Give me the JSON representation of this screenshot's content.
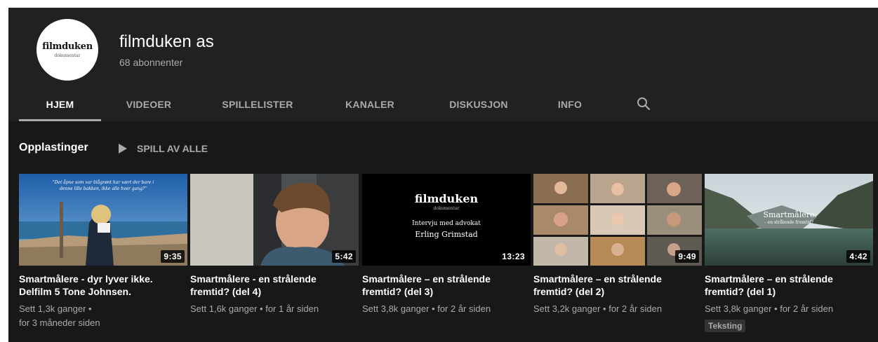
{
  "channel": {
    "name": "filmduken as",
    "subscribers": "68 abonnenter",
    "logo_text": "filmduken",
    "logo_subtext": "dokumentar"
  },
  "tabs": [
    {
      "label": "HJEM",
      "active": true
    },
    {
      "label": "VIDEOER"
    },
    {
      "label": "SPILLELISTER"
    },
    {
      "label": "KANALER"
    },
    {
      "label": "DISKUSJON"
    },
    {
      "label": "INFO"
    }
  ],
  "search_icon": "search-icon",
  "section": {
    "title": "Opplastinger",
    "play_all": "SPILL AV ALLE"
  },
  "videos": [
    {
      "duration": "9:35",
      "title": "Smartmålere - dyr lyver ikke. Delfilm 5 Tone Johnsen.",
      "views": "Sett 1,3k ganger •",
      "age": "for 3 måneder siden",
      "thumb_text": "\"Det åpne som var blågrønt har vært der bare i denne lille bakken, ikke alle hver gang?\""
    },
    {
      "duration": "5:42",
      "title": "Smartmålere - en strålende fremtid? (del 4)",
      "views": "Sett 1,6k ganger",
      "age": "for 1 år siden"
    },
    {
      "duration": "13:23",
      "title": "Smartmålere – en strålende fremtid? (del 3)",
      "views": "Sett 3,8k ganger",
      "age": "for 2 år siden",
      "thumb_brand": "filmduken",
      "thumb_brand_sub": "dokumentar",
      "thumb_line1": "Intervju med advokat",
      "thumb_line2": "Erling Grimstad"
    },
    {
      "duration": "9:49",
      "title": "Smartmålere – en strålende fremtid? (del 2)",
      "views": "Sett 3,2k ganger",
      "age": "for 2 år siden"
    },
    {
      "duration": "4:42",
      "title": "Smartmålere – en strålende fremtid? (del 1)",
      "views": "Sett 3,8k ganger",
      "age": "for 2 år siden",
      "badge": "Teksting",
      "thumb_title": "Smartmålere",
      "thumb_subtitle": "– en strålende fremtid?"
    }
  ]
}
